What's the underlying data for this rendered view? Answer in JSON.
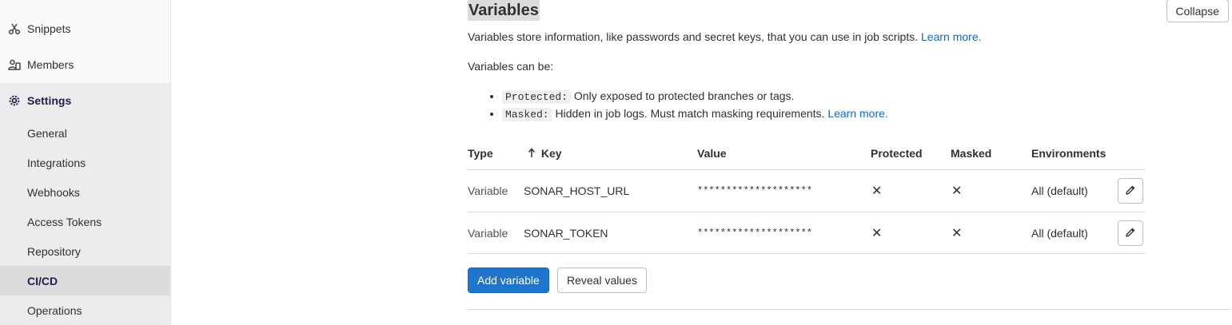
{
  "sidebar": {
    "items": [
      {
        "label": "Snippets",
        "icon": "snippet-icon"
      },
      {
        "label": "Members",
        "icon": "users-icon"
      },
      {
        "label": "Settings",
        "icon": "gear-icon"
      }
    ],
    "settings_subitems": [
      {
        "label": "General"
      },
      {
        "label": "Integrations"
      },
      {
        "label": "Webhooks"
      },
      {
        "label": "Access Tokens"
      },
      {
        "label": "Repository"
      },
      {
        "label": "CI/CD"
      },
      {
        "label": "Operations"
      }
    ],
    "active_subitem": "CI/CD"
  },
  "section": {
    "title": "Variables",
    "collapse_label": "Collapse",
    "description": "Variables store information, like passwords and secret keys, that you can use in job scripts.",
    "learn_more": "Learn more.",
    "can_be": "Variables can be:",
    "bullets": [
      {
        "code": "Protected:",
        "text": "Only exposed to protected branches or tags.",
        "link": ""
      },
      {
        "code": "Masked:",
        "text": "Hidden in job logs. Must match masking requirements.",
        "link": "Learn more."
      }
    ]
  },
  "table": {
    "headers": {
      "type": "Type",
      "key": "Key",
      "key_sort_icon": "arrow-up-icon",
      "value": "Value",
      "protected": "Protected",
      "masked": "Masked",
      "environments": "Environments"
    },
    "rows": [
      {
        "type": "Variable",
        "key": "SONAR_HOST_URL",
        "value": "********************",
        "protected": "✕",
        "masked": "✕",
        "environments": "All (default)"
      },
      {
        "type": "Variable",
        "key": "SONAR_TOKEN",
        "value": "********************",
        "protected": "✕",
        "masked": "✕",
        "environments": "All (default)"
      }
    ]
  },
  "actions": {
    "add_variable": "Add variable",
    "reveal_values": "Reveal values"
  },
  "colors": {
    "primary": "#1f75cb",
    "link": "#1068bf",
    "sidebar_active": "#1f1e4b"
  }
}
